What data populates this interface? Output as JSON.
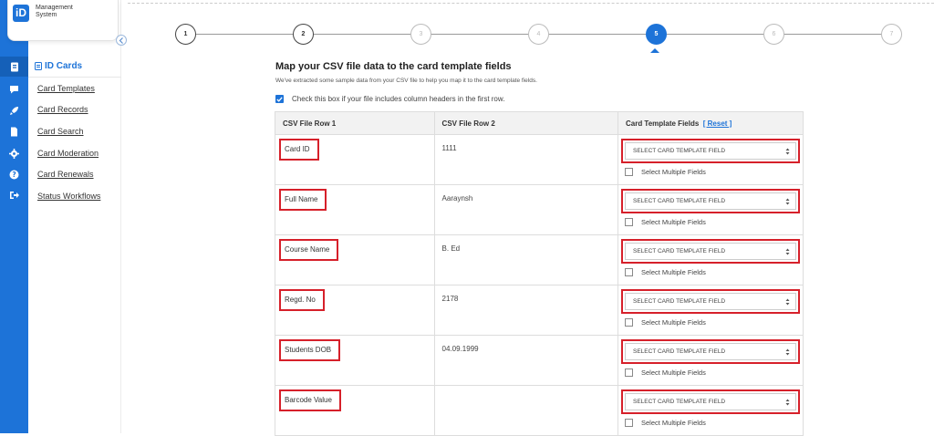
{
  "brand": {
    "logo_mark": "iD",
    "line1": "Management",
    "line2": "System"
  },
  "sidebar": {
    "section_title": "ID Cards",
    "items": [
      {
        "label": "Card Templates"
      },
      {
        "label": "Card Records"
      },
      {
        "label": "Card Search"
      },
      {
        "label": "Card Moderation"
      },
      {
        "label": "Card Renewals"
      },
      {
        "label": "Status Workflows"
      }
    ]
  },
  "stepper": {
    "steps": [
      "1",
      "2",
      "3",
      "4",
      "5",
      "6",
      "7"
    ],
    "active_step": 5
  },
  "main": {
    "title": "Map your CSV file data to the card template fields",
    "subtitle": "We've extracted some sample data from your CSV file to help you map it to the card template fields.",
    "header_checkbox_label": "Check this box if your file includes column headers in the first row.",
    "header_checkbox_checked": true,
    "table": {
      "col1": "CSV File Row 1",
      "col2": "CSV File Row 2",
      "col3": "Card Template Fields",
      "reset_label": "[ Reset ]",
      "select_placeholder": "SELECT CARD TEMPLATE FIELD",
      "multi_label": "Select Multiple Fields",
      "rows": [
        {
          "row1": "Card ID",
          "row2": "1111"
        },
        {
          "row1": "Full Name",
          "row2": "Aaraynsh"
        },
        {
          "row1": "Course Name",
          "row2": "B. Ed"
        },
        {
          "row1": "Regd. No",
          "row2": "2178"
        },
        {
          "row1": "Students DOB",
          "row2": "04.09.1999"
        },
        {
          "row1": "Barcode Value",
          "row2": ""
        }
      ]
    }
  },
  "colors": {
    "accent": "#1d73d8",
    "highlight": "#d6202a"
  },
  "icons": [
    "id-card-icon",
    "chat-icon",
    "rocket-icon",
    "document-icon",
    "gear-icon",
    "help-icon",
    "logout-icon"
  ]
}
